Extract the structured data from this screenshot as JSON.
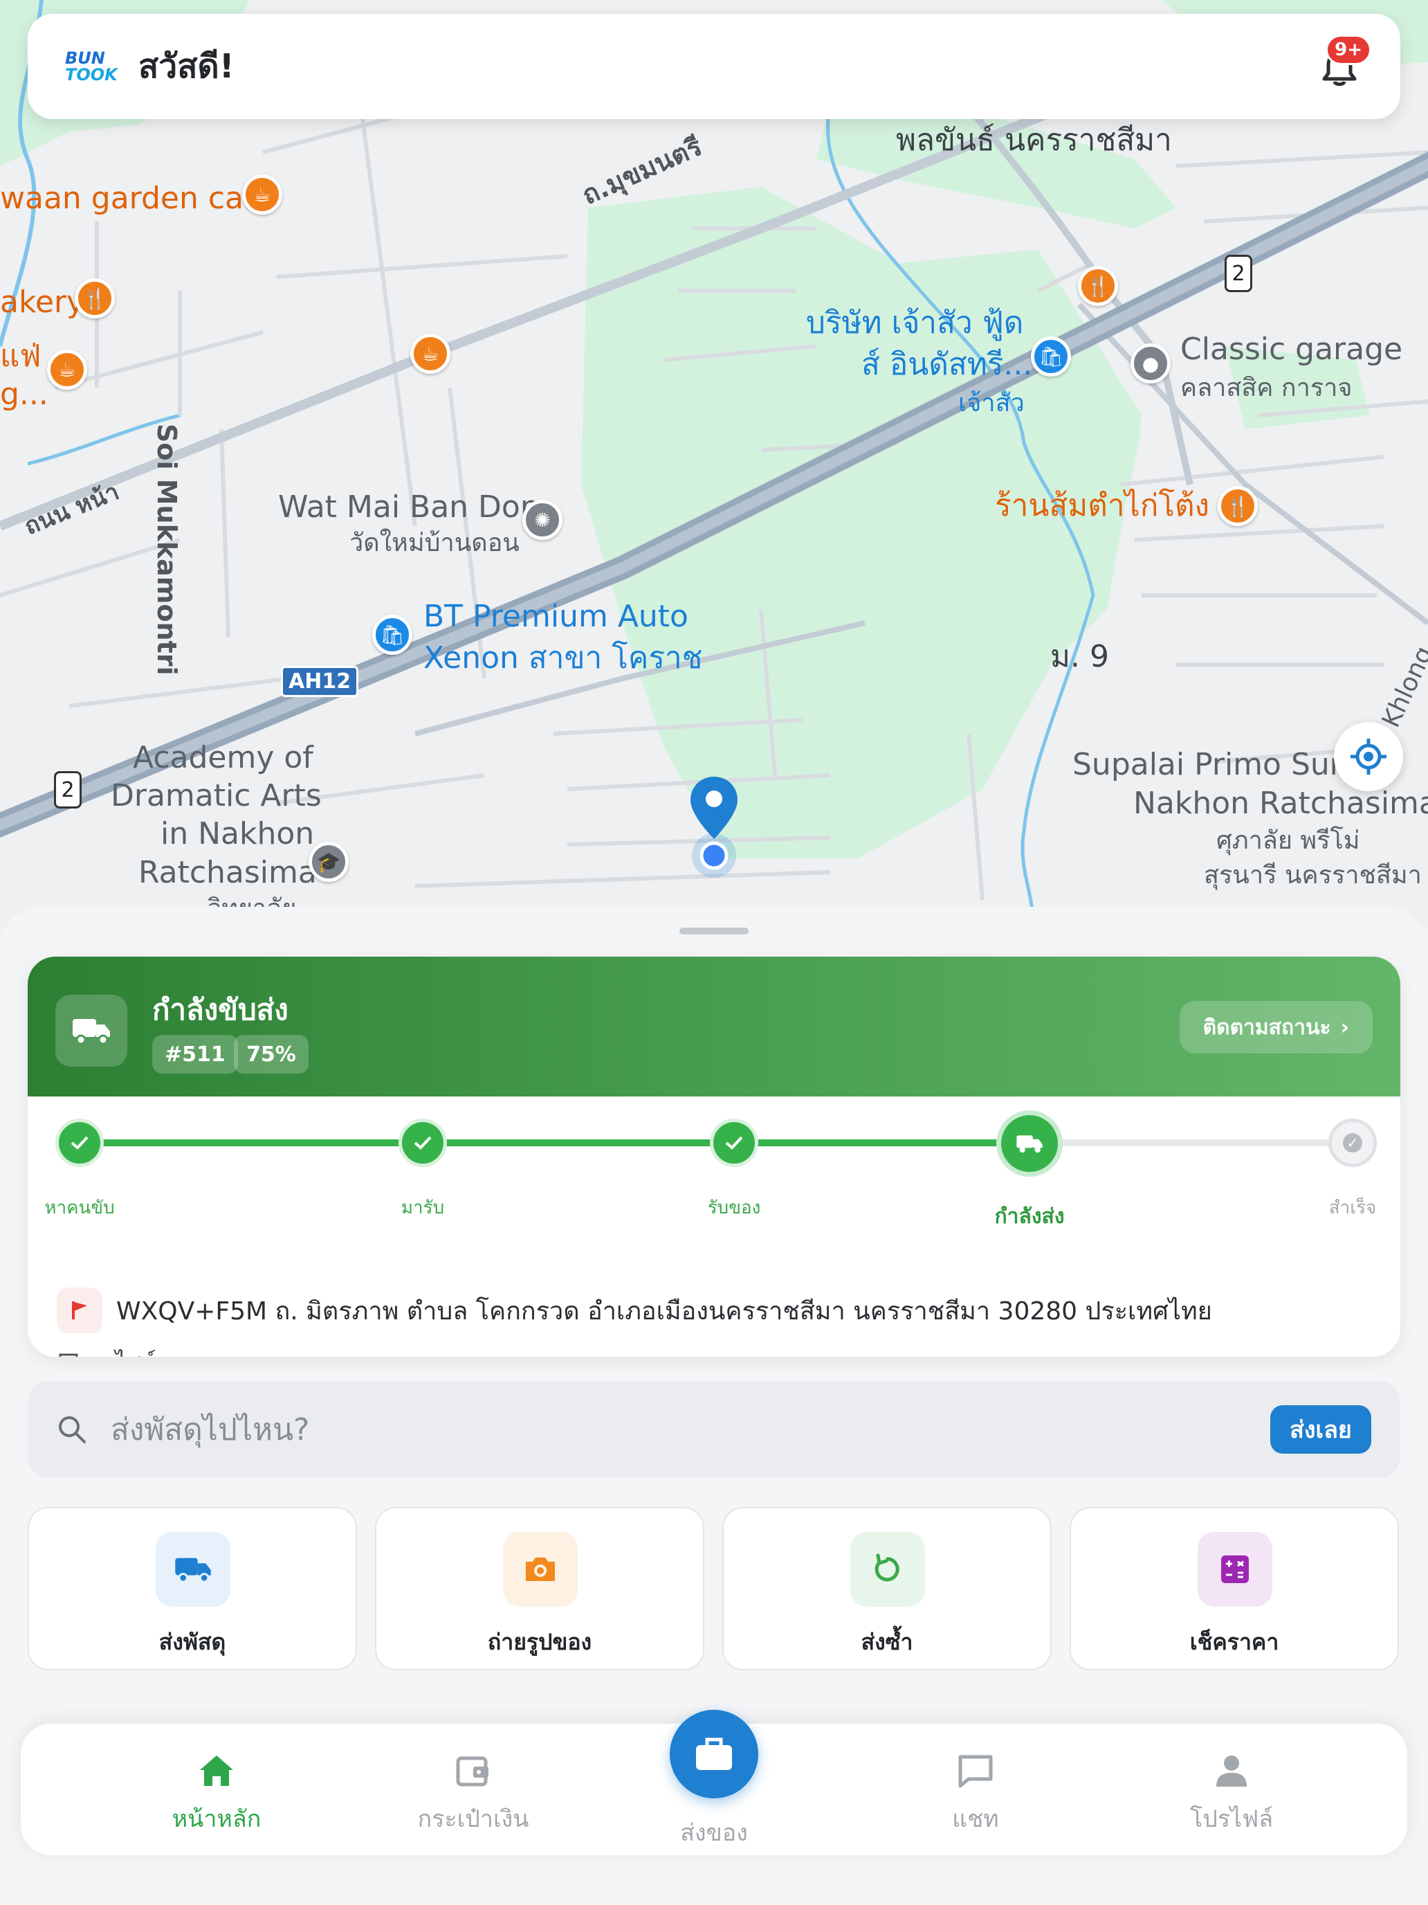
{
  "header": {
    "logo_top": "BUN",
    "logo_bottom": "TOOK",
    "greeting": "สวัสดี!",
    "notification_badge": "9+"
  },
  "map": {
    "labels": {
      "top_center": "พลขันธ์ นครราชสีมา",
      "garden_cafe": "waan garden cafe",
      "bakery": "akery",
      "cafe_partial_1": "แฟ่",
      "cafe_partial_2": "g...",
      "road_mukhamontri_th": "ถ.มุขมนตรี",
      "road_front": "ถนน หน้า",
      "soi": "Soi Mukkamontri",
      "company_line1": "บริษัท เจ้าสัว ฟู้ด",
      "company_line2": "ส์ อินดัสทรี...",
      "company_sub": "เจ้าสัว",
      "classic_garage": "Classic garage",
      "classic_garage_th": "คลาสสิค การาจ",
      "wat_en": "Wat Mai Ban Don",
      "wat_th": "วัดใหม่บ้านดอน",
      "som_tam": "ร้านส้มตำไก่โต้ง",
      "bt_line1": "BT Premium Auto",
      "bt_line2": "Xenon สาขา โคราช",
      "moo9": "ม. 9",
      "khlong": "Khlong",
      "highway_ah": "AH12",
      "highway_num": "2",
      "academy_1": "Academy of",
      "academy_2": "Dramatic Arts",
      "academy_3": "in Nakhon",
      "academy_4": "Ratchasima",
      "academy_5": "วิทยาลัย",
      "supalai_1": "Supalai Primo Surai",
      "supalai_2": "Nakhon Ratchasima",
      "supalai_3": "ศุภาลัย พรีโม่",
      "supalai_4": "สุรนารี นครราชสีมา"
    }
  },
  "delivery": {
    "title": "กำลังขับส่ง",
    "order_id": "#511",
    "progress_label": "75%",
    "progress": 0.75,
    "track_button": "ติดตามสถานะ",
    "steps": [
      {
        "label": "หาคนขับ",
        "state": "done"
      },
      {
        "label": "มารับ",
        "state": "done"
      },
      {
        "label": "รับของ",
        "state": "done"
      },
      {
        "label": "กำลังส่ง",
        "state": "active"
      },
      {
        "label": "สำเร็จ",
        "state": "pending"
      }
    ],
    "address": "WXQV+F5M ถ. มิตรภาพ ตำบล โคกกรวด อำเภอเมืองนครราชสีมา นครราชสีมา 30280 ประเทศไทย",
    "vehicle": "มอไซค์"
  },
  "search": {
    "placeholder": "ส่งพัสดุไปไหน?",
    "button": "ส่งเลย"
  },
  "actions": [
    {
      "label": "ส่งพัสดุ",
      "icon": "truck-icon",
      "color": "#1f7fd0",
      "bg": "#e6f1fb"
    },
    {
      "label": "ถ่ายรูปของ",
      "icon": "camera-icon",
      "color": "#f08a1c",
      "bg": "#fdf1e3"
    },
    {
      "label": "ส่งซ้ำ",
      "icon": "repeat-icon",
      "color": "#3aa84a",
      "bg": "#e8f5ea"
    },
    {
      "label": "เช็คราคา",
      "icon": "calculator-icon",
      "color": "#9c27b0",
      "bg": "#f3e5f5"
    }
  ],
  "nav": {
    "home": "หน้าหลัก",
    "wallet": "กระเป๋าเงิน",
    "send": "ส่งของ",
    "chat": "แชท",
    "profile": "โปรไฟล์"
  },
  "colors": {
    "primary_blue": "#1f7fd0",
    "success_green": "#2ea64a",
    "header_green_dark": "#2c7f33",
    "header_green_light": "#63b569"
  }
}
